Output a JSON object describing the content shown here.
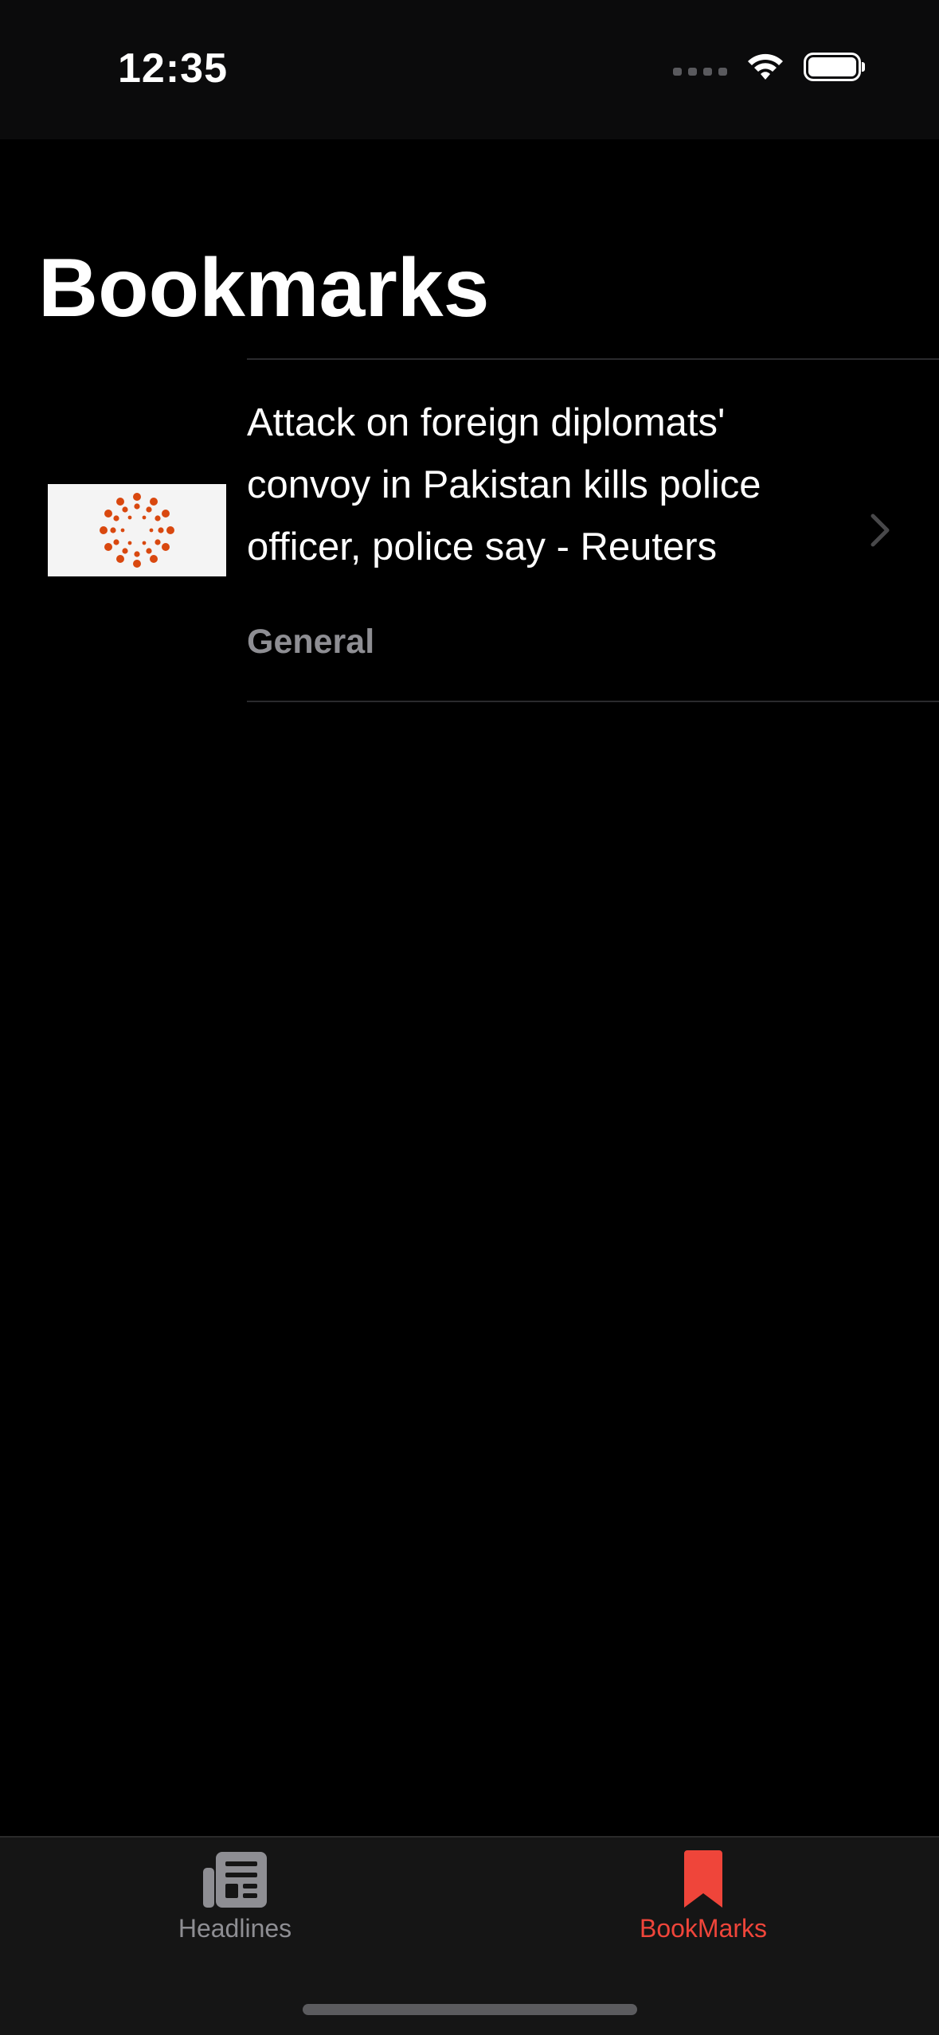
{
  "status_bar": {
    "time": "12:35"
  },
  "page": {
    "title": "Bookmarks"
  },
  "bookmarks": [
    {
      "headline": "Attack on foreign diplomats' convoy in Pakistan kills police officer, police say - Reuters",
      "category": "General",
      "thumbnail_icon": "reuters-logo-icon"
    }
  ],
  "tab_bar": {
    "items": [
      {
        "label": "Headlines",
        "icon": "newspaper-icon",
        "selected": false
      },
      {
        "label": "BookMarks",
        "icon": "bookmark-icon",
        "selected": true
      }
    ]
  },
  "colors": {
    "accent": "#ef453a",
    "brand_orange": "#d9480f",
    "secondary_text": "#8e8e93",
    "background": "#000000"
  }
}
